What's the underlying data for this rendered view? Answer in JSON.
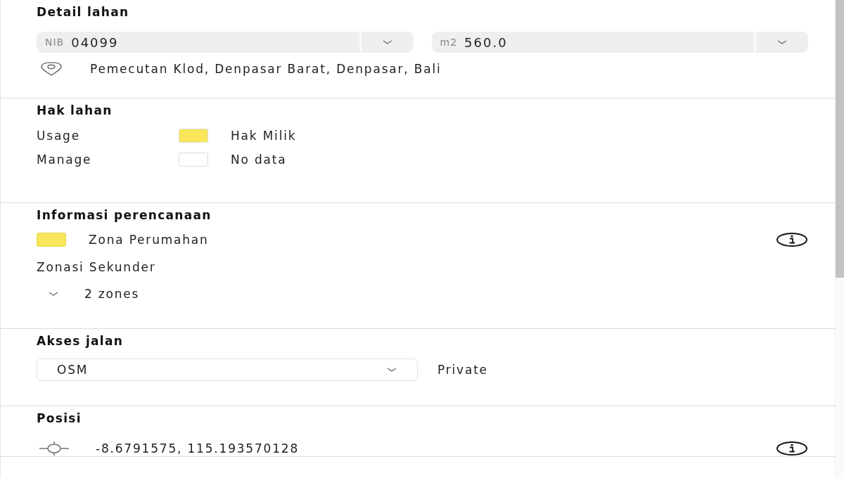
{
  "sections": [
    {
      "kind": "detail",
      "title": "Detail lahan",
      "fields": [
        {
          "prefix": "NIB",
          "value": "04099"
        },
        {
          "prefix": "m2",
          "value": "560.0"
        }
      ],
      "address": "Pemecutan Klod, Denpasar Barat, Denpasar, Bali"
    },
    {
      "kind": "rights",
      "title": "Hak lahan",
      "rows": [
        {
          "label": "Usage",
          "color": "#f9e65b",
          "value": "Hak Milik"
        },
        {
          "label": "Manage",
          "color": "#ffffff",
          "value": "No data"
        }
      ]
    },
    {
      "kind": "planning",
      "title": "Informasi perencanaan",
      "zone": {
        "color": "#f9e65b",
        "name": "Zona Perumahan"
      },
      "secondary_label": "Zonasi Sekunder",
      "secondary": {
        "expanded": false,
        "text": "2 zones"
      }
    },
    {
      "kind": "road",
      "title": "Akses jalan",
      "source": "OSM",
      "access": "Private"
    },
    {
      "kind": "position",
      "title": "Posisi",
      "coords": "-8.6791575, 115.193570128"
    }
  ]
}
